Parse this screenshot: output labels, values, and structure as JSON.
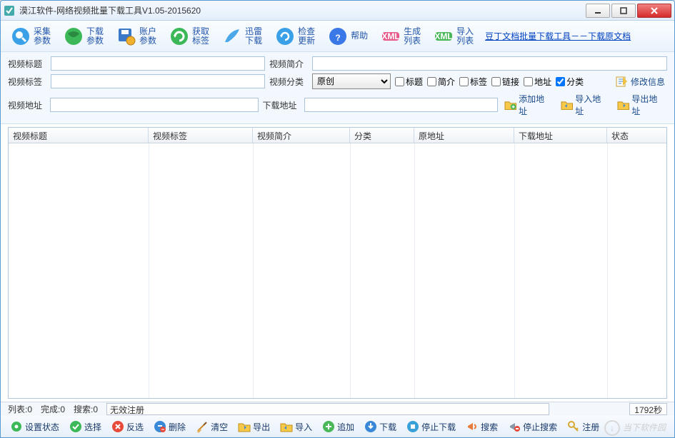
{
  "window": {
    "title": "漠江软件-网络视频批量下载工具V1.05-2015620"
  },
  "toolbar": {
    "items": [
      {
        "l1": "采集",
        "l2": "参数"
      },
      {
        "l1": "下载",
        "l2": "参数"
      },
      {
        "l1": "账户",
        "l2": "参数"
      },
      {
        "l1": "获取",
        "l2": "标签"
      },
      {
        "l1": "迅雷",
        "l2": "下载"
      },
      {
        "l1": "检查",
        "l2": "更新"
      },
      {
        "l1": "帮助",
        "l2": ""
      },
      {
        "l1": "生成",
        "l2": "列表"
      },
      {
        "l1": "导入",
        "l2": "列表"
      }
    ],
    "link_text": "豆丁文档批量下载工具－－下载原文档"
  },
  "form": {
    "lbl_title": "视频标题",
    "lbl_intro": "视频简介",
    "lbl_tags": "视频标签",
    "lbl_category": "视频分类",
    "lbl_addr": "视频地址",
    "lbl_dladdr": "下载地址",
    "val_title": "",
    "val_intro": "",
    "val_tags": "",
    "category_selected": "原创",
    "val_addr": "",
    "val_dladdr": "",
    "chk_title": "标题",
    "chk_intro": "简介",
    "chk_tags": "标签",
    "chk_link": "链接",
    "chk_addr": "地址",
    "chk_cat": "分类",
    "chk_cat_checked": true,
    "btn_editinfo": "修改信息",
    "btn_addaddr": "添加地址",
    "btn_importaddr": "导入地址",
    "btn_exportaddr": "导出地址"
  },
  "table": {
    "columns": [
      "视频标题",
      "视频标签",
      "视频简介",
      "分类",
      "原地址",
      "下载地址",
      "状态"
    ],
    "widths": [
      196,
      146,
      136,
      90,
      140,
      130,
      84
    ]
  },
  "status": {
    "list": "列表:0",
    "done": "完成:0",
    "search": "搜索:0",
    "reg": "无效注册",
    "time": "1792秒"
  },
  "footbar": {
    "items": [
      "设置状态",
      "选择",
      "反选",
      "删除",
      "清空",
      "导出",
      "导入",
      "追加",
      "下载",
      "停止下载",
      "搜索",
      "停止搜索",
      "注册"
    ]
  },
  "watermark": "当下软件园"
}
